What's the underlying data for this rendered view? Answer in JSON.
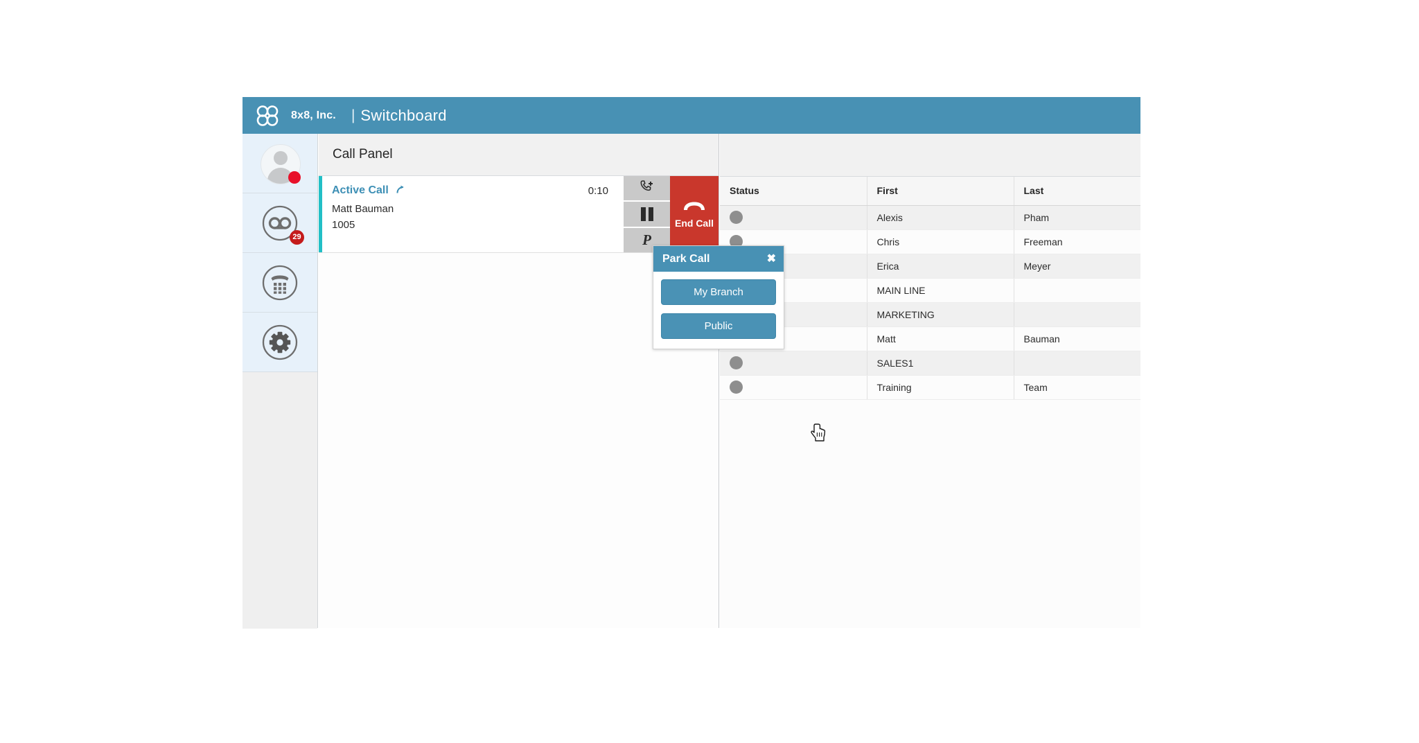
{
  "header": {
    "logo_icon": "8x8-logo-icon",
    "brand": "8x8, Inc.",
    "separator": "|",
    "title": "Switchboard",
    "bg_color": "#4891b4"
  },
  "sidebar": {
    "items": [
      {
        "icon": "user-avatar-icon",
        "name": "profile",
        "badge": "",
        "status_color": "#e8112a"
      },
      {
        "icon": "voicemail-icon",
        "name": "voicemail",
        "badge": "29",
        "status_color": "#c41b1b"
      },
      {
        "icon": "dialpad-phone-icon",
        "name": "dialpad",
        "badge": "",
        "status_color": ""
      },
      {
        "icon": "gear-icon",
        "name": "settings",
        "badge": "",
        "status_color": ""
      }
    ]
  },
  "call_panel": {
    "title": "Call Panel",
    "active_call": {
      "state_label": "Active Call",
      "direction_icon": "inbound-call-arrow-icon",
      "timer": "0:10",
      "caller_name": "Matt Bauman",
      "extension": "1005",
      "accent_color": "#22bfc6"
    },
    "actions": [
      {
        "name": "transfer-call",
        "icon": "phone-plus-icon",
        "label": ""
      },
      {
        "name": "hold-call",
        "icon": "pause-icon",
        "label": ""
      },
      {
        "name": "park-call",
        "icon": "park-p-icon",
        "label": "P"
      }
    ],
    "end_call": {
      "label": "End Call",
      "icon": "hangup-handset-icon",
      "color": "#c9372c"
    }
  },
  "park_popup": {
    "title": "Park Call",
    "close_label": "✖",
    "buttons": [
      {
        "name": "my-branch",
        "label": "My Branch"
      },
      {
        "name": "public",
        "label": "Public"
      }
    ],
    "accent_color": "#4891b4"
  },
  "contacts": {
    "columns": [
      "Status",
      "First",
      "Last"
    ],
    "rows": [
      {
        "status": "available",
        "first": "Alexis",
        "last": "Pham"
      },
      {
        "status": "available",
        "first": "Chris",
        "last": "Freeman"
      },
      {
        "status": "busy",
        "first": "Erica",
        "last": "Meyer"
      },
      {
        "status": "available",
        "first": "MAIN LINE",
        "last": ""
      },
      {
        "status": "available",
        "first": "MARKETING",
        "last": ""
      },
      {
        "status": "busy",
        "first": "Matt",
        "last": "Bauman"
      },
      {
        "status": "available",
        "first": "SALES1",
        "last": ""
      },
      {
        "status": "available",
        "first": "Training",
        "last": "Team"
      }
    ],
    "status_colors": {
      "available": "#8e8e8e",
      "busy": "#e10b16"
    }
  },
  "cursor": {
    "icon": "hand-pointer-cursor",
    "over": "public"
  }
}
